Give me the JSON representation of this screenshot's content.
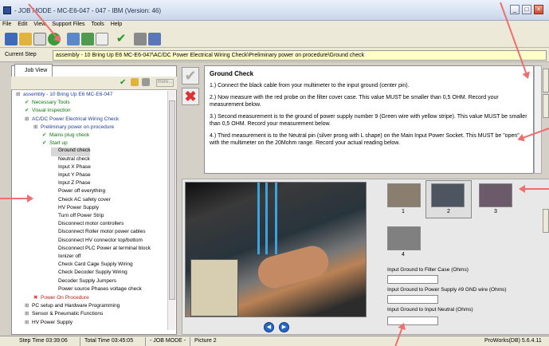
{
  "window": {
    "title": "- JOB MODE - MC-E6-047 - 047 - IBM (Version: 46)",
    "buttons": [
      "_",
      "□",
      "×"
    ]
  },
  "menu": [
    "File",
    "Edit",
    "View",
    "Support Files",
    "Tools",
    "Help"
  ],
  "current_step": {
    "label": "Current Step",
    "value": "assembly - 10 Bring Up E6 MC-E6-047\\AC/DC Power Electrical Wiring Check\\Preliminary power on procedure\\Ground check"
  },
  "left_tab": "Job View",
  "more_button": "more...",
  "tree": [
    {
      "text": "assembly - 10 Bring Up E6 MC-E6-047",
      "style": "blue",
      "indent": 0,
      "mark": "expand"
    },
    {
      "text": "Necessary Tools",
      "style": "green",
      "indent": 1,
      "mark": "check"
    },
    {
      "text": "Visual inspection",
      "style": "green",
      "indent": 1,
      "mark": "check"
    },
    {
      "text": "AC/DC Power Electrical Wiring Check",
      "style": "blue",
      "indent": 1,
      "mark": "expand"
    },
    {
      "text": "Preliminary power on procedure",
      "style": "blue",
      "indent": 2,
      "mark": "expand"
    },
    {
      "text": "Mains plug check",
      "style": "green",
      "indent": 3,
      "mark": "check"
    },
    {
      "text": "Start up",
      "style": "green",
      "indent": 3,
      "mark": "check"
    },
    {
      "text": "Ground check",
      "style": "plain",
      "indent": 4,
      "mark": "none",
      "selected": true
    },
    {
      "text": "Neutral check",
      "style": "plain",
      "indent": 4,
      "mark": "none"
    },
    {
      "text": "Input X Phase",
      "style": "plain",
      "indent": 4,
      "mark": "none"
    },
    {
      "text": "Input Y Phase",
      "style": "plain",
      "indent": 4,
      "mark": "none"
    },
    {
      "text": "Input Z Phase",
      "style": "plain",
      "indent": 4,
      "mark": "none"
    },
    {
      "text": "Power off everything",
      "style": "plain",
      "indent": 4,
      "mark": "none"
    },
    {
      "text": "Check AC safety cover",
      "style": "plain",
      "indent": 4,
      "mark": "none"
    },
    {
      "text": "HV Power Supply",
      "style": "plain",
      "indent": 4,
      "mark": "none"
    },
    {
      "text": "Turn off Power Strip",
      "style": "plain",
      "indent": 4,
      "mark": "none"
    },
    {
      "text": "Disconnect motor controllers",
      "style": "plain",
      "indent": 4,
      "mark": "none"
    },
    {
      "text": "Disconnect Roller motor power cables",
      "style": "plain",
      "indent": 4,
      "mark": "none"
    },
    {
      "text": "Disconnect HV connector top/bottom",
      "style": "plain",
      "indent": 4,
      "mark": "none"
    },
    {
      "text": "Disconnect PLC Power at terminal block",
      "style": "plain",
      "indent": 4,
      "mark": "none"
    },
    {
      "text": "Ionizer off",
      "style": "plain",
      "indent": 4,
      "mark": "none"
    },
    {
      "text": "Check Card Cage Supply Wiring",
      "style": "plain",
      "indent": 4,
      "mark": "none"
    },
    {
      "text": "Check Decoder Supply Wiring",
      "style": "plain",
      "indent": 4,
      "mark": "none"
    },
    {
      "text": "Decoder Supply Jumpers",
      "style": "plain",
      "indent": 4,
      "mark": "none"
    },
    {
      "text": "Power source Phases voltage check",
      "style": "plain",
      "indent": 4,
      "mark": "none"
    },
    {
      "text": "Power On Procedure",
      "style": "red",
      "indent": 2,
      "mark": "cross"
    },
    {
      "text": "PC setup and Hardware Programming",
      "style": "plain",
      "indent": 1,
      "mark": "expand"
    },
    {
      "text": "Sensor & Pneumatic Functions",
      "style": "plain",
      "indent": 1,
      "mark": "expand"
    },
    {
      "text": "HV Power Supply",
      "style": "plain",
      "indent": 1,
      "mark": "expand"
    }
  ],
  "instructions": {
    "heading": "Ground Check",
    "steps": [
      "1.) Connect the black cable from your multimeter to the input ground (center pin).",
      "2.) Now measure with the red probe on the filter cover case. This value MUST be smaller than 0,5 OHM.  Record your measurement below.",
      "3.) Second measurement is to the ground of power supply number 9 (Green wire with yellow stripe). This value MUST be smaller than 0,5 OHM.  Record your measurement below.",
      "4.) Third measurement is to the Neutral pin (silver prong with L shape) on the Main Input Power Socket. This MUST be \"open\"  with the multimeter on the 20Mohm range.  Record your actual reading below."
    ]
  },
  "thumbnails": [
    {
      "label": "1",
      "color": "#8a7f6f"
    },
    {
      "label": "2",
      "color": "#4d5560"
    },
    {
      "label": "3",
      "color": "#6a5a6a"
    },
    {
      "label": "4",
      "color": "#808080"
    }
  ],
  "selected_thumbnail": 2,
  "fields": [
    {
      "label": "Input Ground to Filter Case (Ohms)",
      "value": ""
    },
    {
      "label": "Input Ground to Power Supply #9 GND wire (Ohms)",
      "value": ""
    },
    {
      "label": "Input Ground to Input Neutral (Ohms)",
      "value": ""
    }
  ],
  "status": {
    "step_time": "Step Time 03:39:06",
    "total_time": "Total Time 03:45:05",
    "mode": "- JOB MODE -",
    "picture": "Picture 2",
    "version": "ProWorks(DB) 5.6.4.11"
  },
  "colors": {
    "highlight_field": "#ffffc8",
    "tree_blue": "#1c3fa8",
    "tree_green": "#0b7a0b",
    "tree_red": "#c02010",
    "annotation_arrow": "#ef6e6e"
  }
}
